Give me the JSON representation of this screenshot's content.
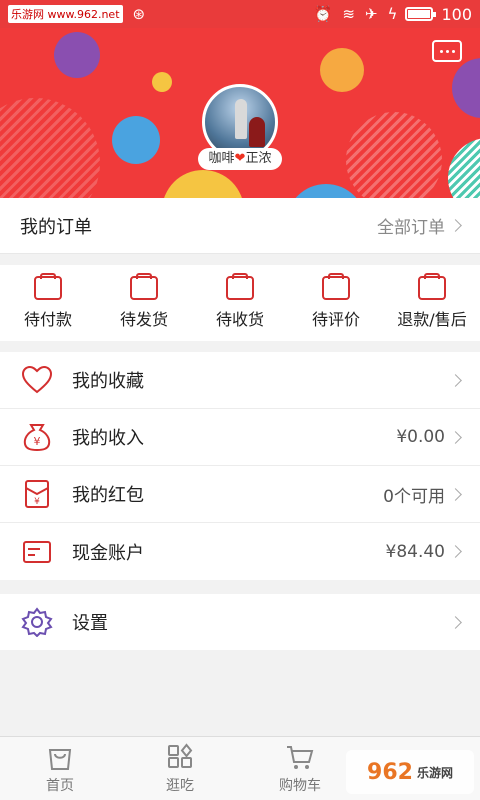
{
  "status_bar": {
    "watermark": "乐游网 www.962.net",
    "battery_pct": "100",
    "icons": [
      "alarm-icon",
      "wifi-icon",
      "airplane-icon",
      "charging-icon",
      "battery-icon"
    ]
  },
  "header": {
    "nickname_left": "咖啡",
    "nickname_right": "正浓",
    "heart": "❤",
    "bg_color": "#f03a3a"
  },
  "order": {
    "title": "我的订单",
    "all_label": "全部订单"
  },
  "order_status": [
    {
      "label": "待付款",
      "icon": "wallet-icon"
    },
    {
      "label": "待发货",
      "icon": "box-icon"
    },
    {
      "label": "待收货",
      "icon": "package-icon"
    },
    {
      "label": "待评价",
      "icon": "comment-icon"
    },
    {
      "label": "退款/售后",
      "icon": "return-icon"
    }
  ],
  "menu": [
    {
      "label": "我的收藏",
      "value": "",
      "icon": "heart-icon"
    },
    {
      "label": "我的收入",
      "value": "¥0.00",
      "icon": "money-bag-icon"
    },
    {
      "label": "我的红包",
      "value": "0个可用",
      "icon": "red-envelope-icon"
    },
    {
      "label": "现金账户",
      "value": "¥84.40",
      "icon": "card-icon"
    }
  ],
  "settings": {
    "label": "设置",
    "icon": "gear-icon"
  },
  "bottom_nav": [
    {
      "label": "首页",
      "icon": "bag-icon"
    },
    {
      "label": "逛吃",
      "icon": "grid-icon"
    },
    {
      "label": "购物车",
      "icon": "cart-icon"
    }
  ],
  "logo": {
    "main": "962",
    "suffix": "乐游网"
  },
  "accent": "#d32f2f"
}
